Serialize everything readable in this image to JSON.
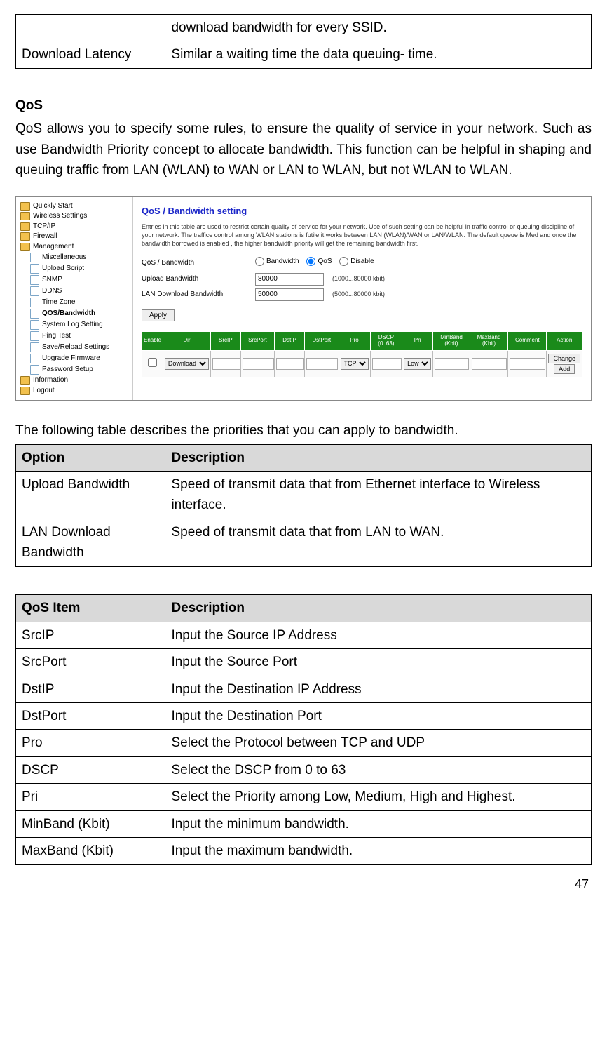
{
  "top_table": {
    "rows": [
      {
        "left": "",
        "right": "download bandwidth for every SSID."
      },
      {
        "left": "Download Latency",
        "right": "Similar a waiting time the data queuing- time."
      }
    ]
  },
  "section": {
    "heading": "QoS",
    "paragraph": "QoS allows you to specify some rules, to ensure the quality of service in your network. Such as use Bandwidth Priority concept to allocate bandwidth. This function can be helpful in shaping and queuing traffic from LAN (WLAN) to WAN or LAN to WLAN, but not WLAN to WLAN."
  },
  "screenshot": {
    "nav_top": [
      "Quickly Start",
      "Wireless Settings",
      "TCP/IP",
      "Firewall",
      "Management"
    ],
    "nav_sub": [
      "Miscellaneous",
      "Upload Script",
      "SNMP",
      "DDNS",
      "Time Zone",
      "QOS/Bandwidth",
      "System Log Setting",
      "Ping Test",
      "Save/Reload Settings",
      "Upgrade Firmware",
      "Password Setup"
    ],
    "nav_bottom": [
      "Information",
      "Logout"
    ],
    "nav_bold": "QOS/Bandwidth",
    "title": "QoS / Bandwidth setting",
    "desc": "Entries in this table are used to restrict certain quality of service for your network. Use of such setting can be helpful in traffic control or queuing discipline of your network. The traffice control among WLAN stations is futile,it works between LAN (WLAN)/WAN or LAN/WLAN. The default queue is Med and once the bandwidth borrowed is enabled , the higher bandwidth priority will get the remaining bandwidth first.",
    "form": {
      "mode_label": "QoS / Bandwidth",
      "radios": [
        "Bandwidth",
        "QoS",
        "Disable"
      ],
      "selected_radio": "QoS",
      "upload_label": "Upload Bandwidth",
      "upload_value": "80000",
      "upload_hint": "(1000...80000 kbit)",
      "lan_label": "LAN Download Bandwidth",
      "lan_value": "50000",
      "lan_hint": "(5000...80000 kbit)",
      "apply": "Apply"
    },
    "grid_headers": [
      "Enable",
      "Dir",
      "SrcIP",
      "SrcPort",
      "DstIP",
      "DstPort",
      "Pro",
      "DSCP (0..63)",
      "Pri",
      "MinBand (Kbit)",
      "MaxBand (Kbit)",
      "Comment",
      "Action"
    ],
    "grid_row": {
      "dir": "Download",
      "pro": "TCP",
      "pri": "Low",
      "btn1": "Change",
      "btn2": "Add"
    }
  },
  "after_figure_text": "The following table describes the priorities that you can apply to bandwidth.",
  "option_table": {
    "headers": [
      "Option",
      "Description"
    ],
    "rows": [
      {
        "left": "Upload Bandwidth",
        "right": "Speed of transmit data that from Ethernet interface to Wireless interface."
      },
      {
        "left": "LAN Download Bandwidth",
        "right": "Speed of transmit data that from LAN to WAN."
      }
    ]
  },
  "qos_table": {
    "headers": [
      "QoS Item",
      "Description"
    ],
    "rows": [
      {
        "left": "SrcIP",
        "right": "Input the Source IP Address"
      },
      {
        "left": "SrcPort",
        "right": "Input the Source Port"
      },
      {
        "left": "DstIP",
        "right": "Input the Destination IP Address"
      },
      {
        "left": "DstPort",
        "right": "Input the Destination Port"
      },
      {
        "left": "Pro",
        "right": "Select the Protocol between TCP and UDP"
      },
      {
        "left": "DSCP",
        "right": "Select the DSCP from 0 to 63"
      },
      {
        "left": "Pri",
        "right": "Select the Priority among Low, Medium, High and Highest."
      },
      {
        "left": "MinBand (Kbit)",
        "right": "Input the minimum bandwidth."
      },
      {
        "left": "MaxBand (Kbit)",
        "right": "Input the maximum bandwidth."
      }
    ]
  },
  "page_number": "47"
}
